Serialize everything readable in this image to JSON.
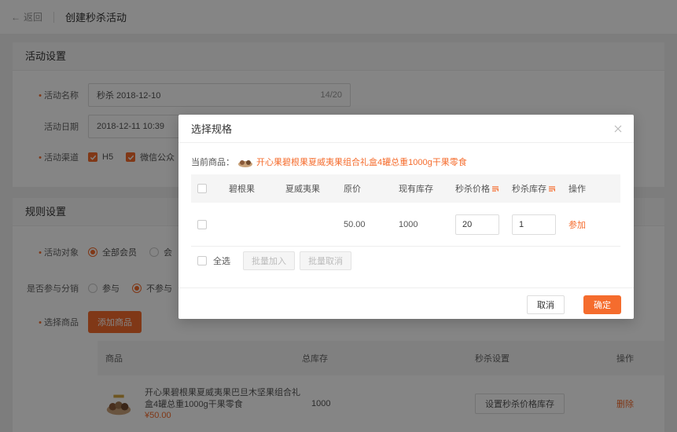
{
  "topbar": {
    "back_label": "返回",
    "title": "创建秒杀活动"
  },
  "activity_settings": {
    "section_title": "活动设置",
    "name": {
      "label": "活动名称",
      "value": "秒杀 2018-12-10",
      "counter": "14/20"
    },
    "date": {
      "label": "活动日期",
      "value": "2018-12-11 10:39"
    },
    "channel": {
      "label": "活动渠道",
      "options": [
        "H5",
        "微信公众"
      ]
    }
  },
  "rule_settings": {
    "section_title": "规则设置",
    "target": {
      "label": "活动对象",
      "options": [
        "全部会员",
        "会"
      ]
    },
    "distribution": {
      "label": "是否参与分销",
      "options": [
        "参与",
        "不参与"
      ]
    },
    "select_goods": {
      "label": "选择商品",
      "button": "添加商品"
    },
    "goods_table": {
      "headers": [
        "商品",
        "总库存",
        "秒杀设置",
        "操作"
      ],
      "rows": [
        {
          "name": "开心果碧根果夏威夷果巴旦木坚果组合礼盒4罐总重1000g干果零食",
          "price": "¥50.00",
          "stock": "1000",
          "setting_button": "设置秒杀价格库存",
          "action": "删除"
        }
      ]
    }
  },
  "modal": {
    "title": "选择规格",
    "current_label": "当前商品：",
    "current_product": "开心果碧根果夏威夷果组合礼盒4罐总重1000g干果零食",
    "headers": [
      "碧根果",
      "夏威夷果",
      "原价",
      "现有库存",
      "秒杀价格",
      "秒杀库存",
      "操作"
    ],
    "rows": [
      {
        "c1": "",
        "c2": "",
        "price": "50.00",
        "stock": "1000",
        "seckill_price": "20",
        "seckill_stock": "1",
        "action": "参加"
      }
    ],
    "select_all": "全选",
    "batch_add": "批量加入",
    "batch_cancel": "批量取消",
    "cancel": "取消",
    "confirm": "确定"
  },
  "colors": {
    "accent": "#f56c2d"
  }
}
